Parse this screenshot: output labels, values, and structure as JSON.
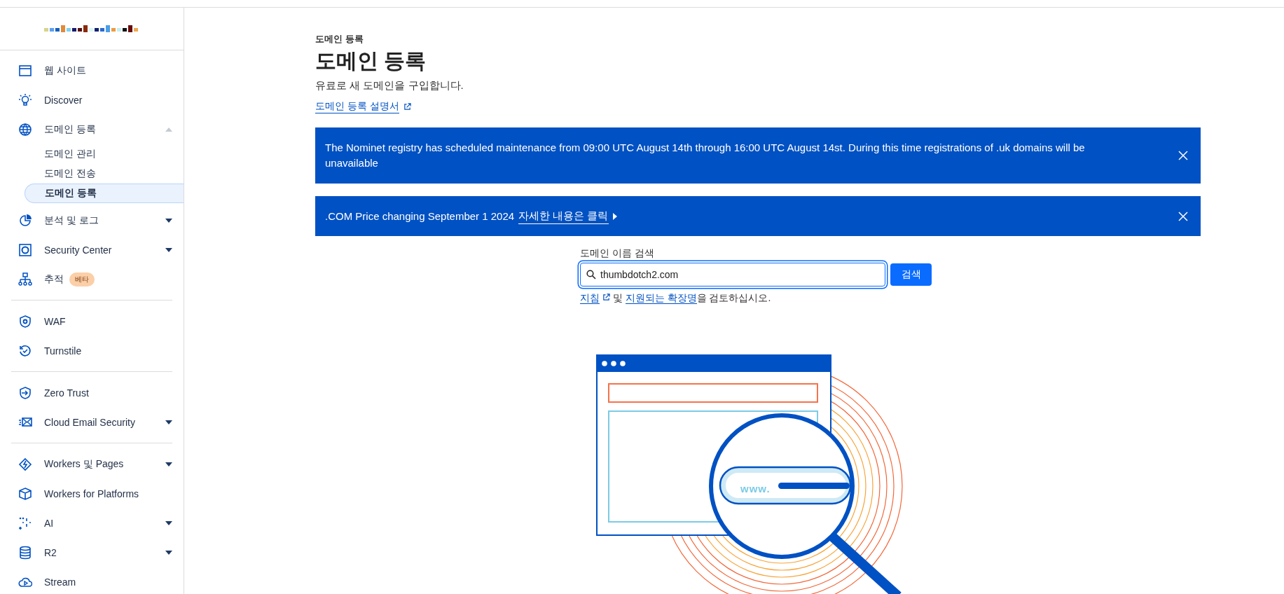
{
  "sidebar": {
    "sections": [
      {
        "items": [
          {
            "label": "웹 사이트",
            "kind": "link"
          },
          {
            "label": "Discover",
            "kind": "link"
          },
          {
            "label": "도메인 등록",
            "kind": "group",
            "expanded": true,
            "children": [
              {
                "label": "도메인 관리",
                "selected": false
              },
              {
                "label": "도메인 전송",
                "selected": false
              },
              {
                "label": "도메인 등록",
                "selected": true
              }
            ]
          },
          {
            "label": "분석 및 로그",
            "kind": "group",
            "expanded": false
          },
          {
            "label": "Security Center",
            "kind": "group",
            "expanded": false
          },
          {
            "label": "추적",
            "kind": "link",
            "badge": "베타"
          }
        ]
      },
      {
        "items": [
          {
            "label": "WAF",
            "kind": "link"
          },
          {
            "label": "Turnstile",
            "kind": "link"
          }
        ]
      },
      {
        "items": [
          {
            "label": "Zero Trust",
            "kind": "link"
          },
          {
            "label": "Cloud Email Security",
            "kind": "group",
            "expanded": false
          }
        ]
      },
      {
        "items": [
          {
            "label": "Workers 및 Pages",
            "kind": "group",
            "expanded": false
          },
          {
            "label": "Workers for Platforms",
            "kind": "link"
          },
          {
            "label": "AI",
            "kind": "group",
            "expanded": false
          },
          {
            "label": "R2",
            "kind": "group",
            "expanded": false
          },
          {
            "label": "Stream",
            "kind": "link"
          }
        ]
      }
    ]
  },
  "header": {
    "breadcrumb": "도메인 등록",
    "title": "도메인 등록",
    "subtitle": "유료로 새 도메인을 구입합니다.",
    "guide_link": "도메인 등록 설명서"
  },
  "banners": [
    {
      "text": "The Nominet registry has scheduled maintenance from 09:00 UTC August 14th through 16:00 UTC August 14st. During this time registrations of .uk domains will be unavailable"
    },
    {
      "text": ".COM Price changing September 1 2024",
      "link": "자세한 내용은 클릭"
    }
  ],
  "search": {
    "label": "도메인 이름 검색",
    "value": "thumbdotch2.com",
    "focused": true,
    "button": "검색",
    "help": {
      "link_1": "지침",
      "middle": " 및 ",
      "link_2": "지원되는 확장명",
      "end": "을 검토하십시오."
    }
  },
  "illustration": {
    "url_text": "www."
  }
}
